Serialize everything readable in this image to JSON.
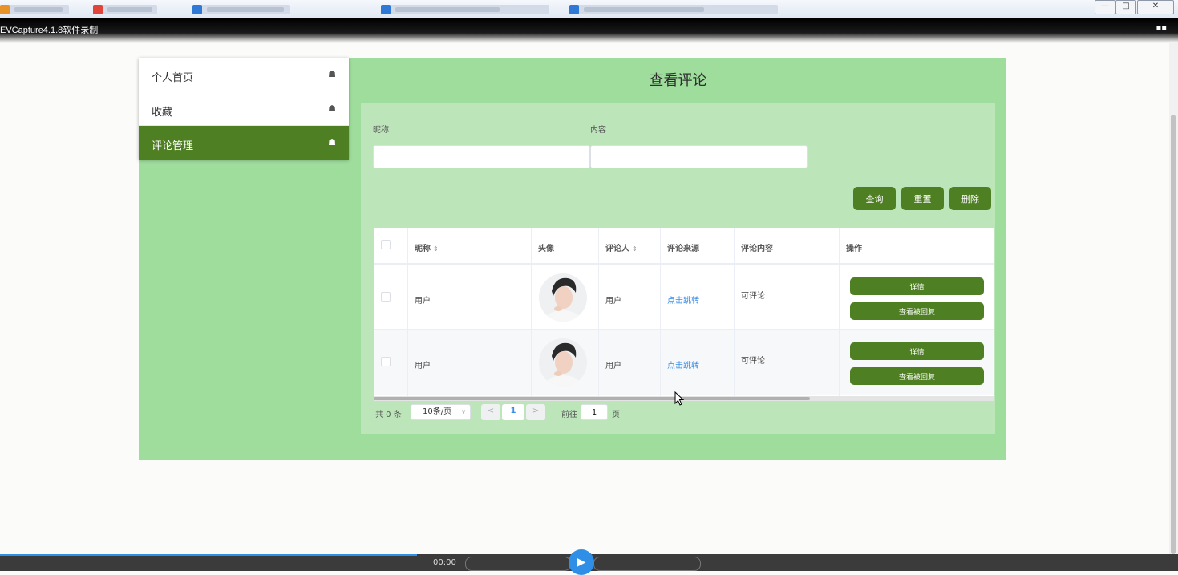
{
  "capture_title": "EVCapture4.1.8软件录制",
  "menu": {
    "items": [
      {
        "label": "个人首页",
        "icon": "home-icon",
        "active": false
      },
      {
        "label": "收藏",
        "icon": "home-icon",
        "active": false
      },
      {
        "label": "评论管理",
        "icon": "home-icon",
        "active": true
      }
    ]
  },
  "panel": {
    "title": "查看评论"
  },
  "search": {
    "nickname_label": "昵称",
    "nickname_value": "",
    "content_label": "内容",
    "content_value": "",
    "query_btn": "查询",
    "reset_btn": "重置",
    "delete_btn": "删除"
  },
  "table": {
    "headers": [
      "昵称",
      "头像",
      "评论人",
      "评论来源",
      "评论内容",
      "操作"
    ],
    "rows": [
      {
        "nickname": "用户",
        "avatar": "user-avatar",
        "commenter": "用户",
        "source": "点击跳转",
        "content": "可评论",
        "detail_btn": "详情",
        "reply_btn": "查看被回复"
      },
      {
        "nickname": "用户",
        "avatar": "user-avatar",
        "commenter": "用户",
        "source": "点击跳转",
        "content": "可评论",
        "detail_btn": "详情",
        "reply_btn": "查看被回复"
      }
    ]
  },
  "pagination": {
    "total": "共 0 条",
    "page_size": "10条/页",
    "current_page": "1",
    "goto_label": "前往",
    "goto_value": "1",
    "page_suffix": "页"
  },
  "player": {
    "time": "00:00"
  },
  "colors": {
    "accent": "#4e7f22",
    "app_bg": "#9edd9c",
    "panel_bg": "#bce5ba",
    "link": "#3a8ee6"
  }
}
